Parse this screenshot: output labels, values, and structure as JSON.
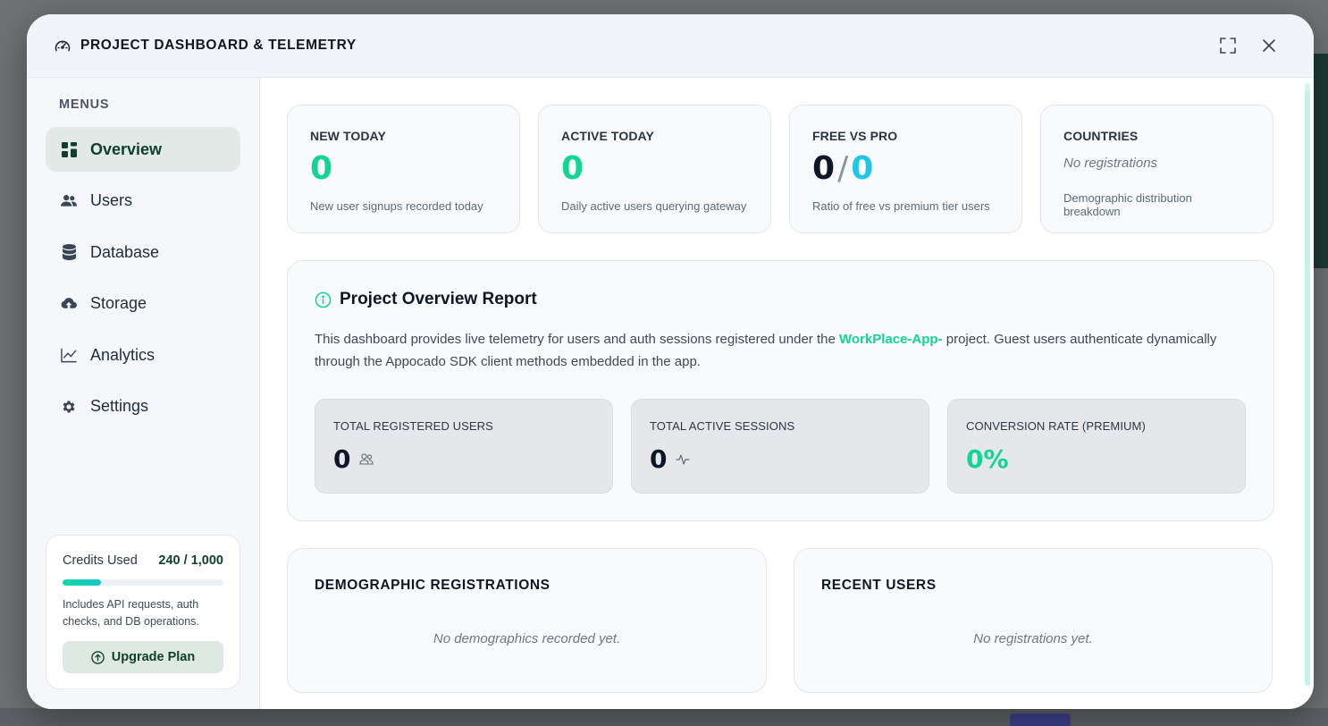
{
  "modal": {
    "title": "PROJECT DASHBOARD & TELEMETRY"
  },
  "sidebar": {
    "menus_label": "MENUS",
    "items": [
      {
        "label": "Overview",
        "icon": "grid-icon",
        "active": true
      },
      {
        "label": "Users",
        "icon": "users-icon",
        "active": false
      },
      {
        "label": "Database",
        "icon": "database-icon",
        "active": false
      },
      {
        "label": "Storage",
        "icon": "cloud-upload-icon",
        "active": false
      },
      {
        "label": "Analytics",
        "icon": "line-chart-icon",
        "active": false
      },
      {
        "label": "Settings",
        "icon": "gear-icon",
        "active": false
      }
    ],
    "credits": {
      "label": "Credits Used",
      "value": "240 / 1,000",
      "used_fraction": 0.24,
      "note": "Includes API requests, auth checks, and DB operations.",
      "upgrade_label": "Upgrade Plan"
    }
  },
  "stats": [
    {
      "title": "NEW TODAY",
      "value": "0",
      "desc": "New user signups recorded today"
    },
    {
      "title": "ACTIVE TODAY",
      "value": "0",
      "desc": "Daily active users querying gateway"
    },
    {
      "title": "FREE VS PRO",
      "free": "0",
      "slash": "/",
      "pro": "0",
      "desc": "Ratio of free vs premium tier users"
    },
    {
      "title": "COUNTRIES",
      "empty": "No registrations",
      "desc": "Demographic distribution breakdown"
    }
  ],
  "report": {
    "title": "Project Overview Report",
    "text_before": "This dashboard provides live telemetry for users and auth sessions registered under the ",
    "project_name": "WorkPlace-App-",
    "text_after": " project. Guest users authenticate dynamically through the Appocado SDK client methods embedded in the app.",
    "metrics": [
      {
        "label": "TOTAL REGISTERED USERS",
        "value": "0",
        "icon": "users-outline-icon"
      },
      {
        "label": "TOTAL ACTIVE SESSIONS",
        "value": "0",
        "icon": "activity-icon"
      },
      {
        "label": "CONVERSION RATE (PREMIUM)",
        "value": "0%"
      }
    ]
  },
  "panels": {
    "demographics": {
      "title": "DEMOGRAPHIC REGISTRATIONS",
      "empty": "No demographics recorded yet."
    },
    "recent_users": {
      "title": "RECENT USERS",
      "empty": "No registrations yet."
    }
  },
  "colors": {
    "accent": "#11d691",
    "brand_dark": "#0d3f2c",
    "pro_cyan": "#1fc6e6"
  }
}
